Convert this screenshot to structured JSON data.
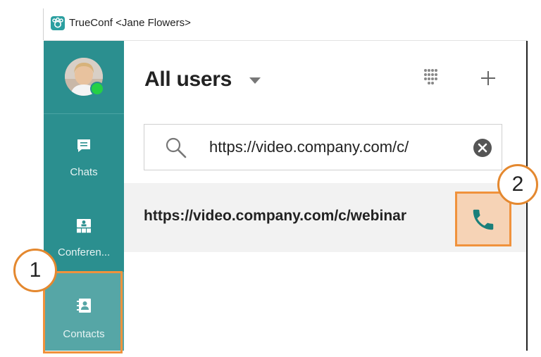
{
  "window": {
    "title": "TrueConf <Jane Flowers>"
  },
  "sidebar": {
    "presence_color": "#25d045",
    "items": [
      {
        "label": "Chats",
        "icon": "chat-icon"
      },
      {
        "label": "Conferen...",
        "icon": "conference-icon"
      },
      {
        "label": "Contacts",
        "icon": "contacts-icon",
        "active": true
      }
    ]
  },
  "header": {
    "title": "All users",
    "icons": [
      "chevron-down-icon",
      "dialpad-icon",
      "plus-icon"
    ]
  },
  "search": {
    "value": "https://video.company.com/c/"
  },
  "results": [
    {
      "text": "https://video.company.com/c/webinar",
      "action_icon": "phone-icon"
    }
  ],
  "annotations": [
    {
      "label": "1",
      "color": "#f0923c"
    },
    {
      "label": "2",
      "color": "#f0923c"
    }
  ],
  "colors": {
    "sidebar": "#2b8f8f",
    "active_item": "#56a6a6",
    "accent": "#1a7f7a",
    "highlight": "#f0923c"
  }
}
